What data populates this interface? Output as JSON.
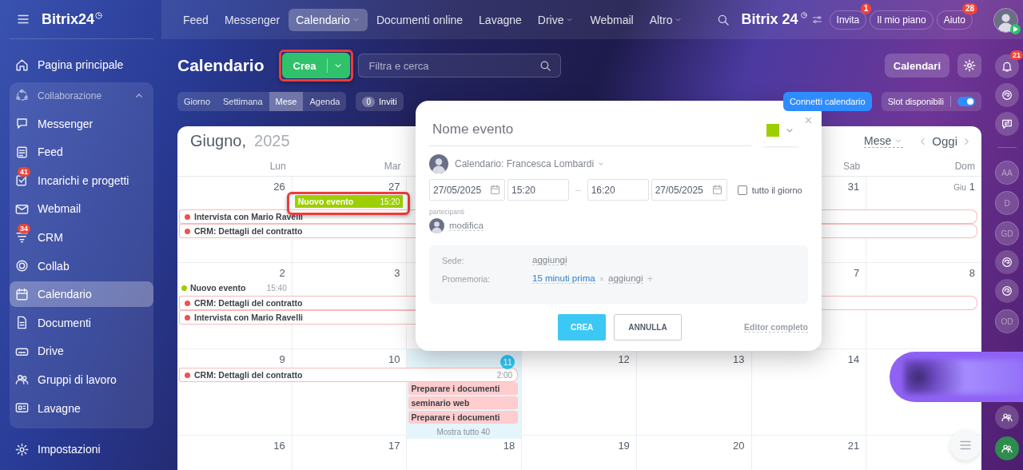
{
  "sidebar": {
    "logo": "Bitrix24",
    "items": [
      {
        "label": "Pagina principale",
        "selected": false
      }
    ],
    "group": {
      "label": "Collaborazione",
      "expanded": true,
      "items": [
        {
          "label": "Messenger",
          "selected": false
        },
        {
          "label": "Feed",
          "selected": false
        },
        {
          "label": "Incarichi e progetti",
          "badge": "41",
          "selected": false
        },
        {
          "label": "Webmail",
          "selected": false
        },
        {
          "label": "CRM",
          "badge": "34",
          "selected": false
        },
        {
          "label": "Collab",
          "selected": false
        },
        {
          "label": "Calendario",
          "selected": true
        },
        {
          "label": "Documenti",
          "selected": false
        },
        {
          "label": "Drive",
          "selected": false
        },
        {
          "label": "Gruppi di lavoro",
          "selected": false
        },
        {
          "label": "Lavagne",
          "selected": false
        }
      ]
    },
    "footer": "Impostazioni"
  },
  "topnav": {
    "items": [
      {
        "label": "Feed",
        "selected": false,
        "dropdown": false
      },
      {
        "label": "Messenger",
        "selected": false,
        "dropdown": false
      },
      {
        "label": "Calendario",
        "selected": true,
        "dropdown": true
      },
      {
        "label": "Documenti online",
        "selected": false,
        "dropdown": false
      },
      {
        "label": "Lavagne",
        "selected": false,
        "dropdown": false
      },
      {
        "label": "Drive",
        "selected": false,
        "dropdown": true
      },
      {
        "label": "Webmail",
        "selected": false,
        "dropdown": false
      },
      {
        "label": "Altro",
        "selected": false,
        "dropdown": true
      }
    ],
    "logo": "Bitrix 24",
    "buttons": [
      {
        "label": "Invita",
        "badge": "1"
      },
      {
        "label": "Il mio piano"
      },
      {
        "label": "Aiuto",
        "badge": "28"
      }
    ]
  },
  "toolbar": {
    "title": "Calendario",
    "create": {
      "label": "Crea",
      "highlighted": true
    },
    "search": {
      "placeholder": "Filtra e cerca"
    },
    "calendars_button": "Calendari"
  },
  "views": [
    {
      "label": "Giorno",
      "selected": false
    },
    {
      "label": "Settimana",
      "selected": false
    },
    {
      "label": "Mese",
      "selected": true
    },
    {
      "label": "Agenda",
      "selected": false
    }
  ],
  "invites": {
    "count": "0",
    "label": "Inviti"
  },
  "connect_button": "Connetti calendario",
  "slots": {
    "label": "Slot disponibili",
    "on": true
  },
  "calendar": {
    "month": "Giugno,",
    "year": "2025",
    "view_select": "Mese",
    "today_button": "Oggi",
    "weekdays": {
      "mon": "Lun",
      "tue": "Mar",
      "sat": "Sab",
      "sun": "Dom"
    },
    "weeks": [
      {
        "days": {
          "mon": {
            "number": "26",
            "today": false
          },
          "tue": {
            "number": "27",
            "today": false
          },
          "sat": {
            "number": "31",
            "today": false
          },
          "sun": {
            "month": "Giu",
            "number": "1",
            "today": false
          }
        },
        "lanes": [
          [
            {
              "kind": "fill",
              "title": "Nuovo evento",
              "time": "15:20",
              "color": "#9dcf00",
              "highlighted": true
            }
          ],
          [
            {
              "kind": "bar",
              "title": "Intervista con Mario Ravelli",
              "color": "#f0524f"
            }
          ],
          [
            {
              "kind": "bar",
              "title": "CRM: Dettagli del contratto",
              "color": "#f0524f"
            }
          ]
        ]
      },
      {
        "days": {
          "mon": {
            "number": "2",
            "today": false
          },
          "tue": {
            "number": "3",
            "today": false
          },
          "sat": {
            "number": "7",
            "today": false
          },
          "sun": {
            "number": "8",
            "today": false
          }
        },
        "lanes": [
          [
            {
              "kind": "dot",
              "title": "Nuovo evento",
              "time": "15:40",
              "color": "#9dcf00"
            }
          ],
          [
            {
              "kind": "bar",
              "title": "CRM: Dettagli del contratto",
              "color": "#f0524f"
            }
          ],
          [
            {
              "kind": "bar",
              "title": "Intervista con Mario Ravelli",
              "color": "#f0524f"
            }
          ]
        ]
      },
      {
        "days": {
          "mon": {
            "number": "9",
            "today": false
          },
          "tue": {
            "number": "10",
            "today": false
          },
          "wed": {
            "number": "11",
            "today": true
          },
          "thu": {
            "number": "12",
            "today": false
          },
          "fri": {
            "number": "13",
            "today": false
          },
          "sat": {
            "number": "14",
            "today": false
          }
        },
        "lanes": [
          [
            {
              "kind": "bar",
              "title": "CRM: Dettagli del contratto",
              "time": "2:00",
              "color": "#f0524f"
            }
          ],
          [
            {
              "kind": "block",
              "title": "Preparare i documenti",
              "color": "#ffcdcd"
            }
          ],
          [
            {
              "kind": "block",
              "title": "seminario web",
              "color": "#ffcdcd"
            }
          ],
          [
            {
              "kind": "block",
              "title": "Preparare i documenti",
              "color": "#ffcdcd"
            }
          ],
          [
            {
              "kind": "more",
              "title": "Mostra tutto 40"
            }
          ]
        ]
      },
      {
        "days": {
          "mon": {
            "number": "16",
            "today": false
          },
          "tue": {
            "number": "17",
            "today": false
          },
          "wed": {
            "number": "18",
            "today": false
          },
          "thu": {
            "number": "19",
            "today": false
          },
          "fri": {
            "number": "20",
            "today": false
          },
          "sat": {
            "number": "21",
            "today": false
          }
        }
      }
    ]
  },
  "popup": {
    "title_placeholder": "Nome evento",
    "color": "#9dcf00",
    "close": "×",
    "calendar": "Calendario: Francesca Lombardi",
    "date_from": "27/05/2025",
    "time_from": "15:20",
    "separator": "–",
    "time_to": "16:20",
    "date_to": "27/05/2025",
    "all_day": {
      "label": "tutto il giorno",
      "checked": false
    },
    "participants_label": "partecipanti",
    "participants_link": "modifica",
    "location": {
      "label": "Sede:",
      "value": "aggiungi"
    },
    "reminder": {
      "label": "Promemoria:",
      "value": "15 minuti prima",
      "remove": "×",
      "add": "aggiungi",
      "plus": "+"
    },
    "buttons": [
      {
        "label": "CREA",
        "kind": "primary"
      },
      {
        "label": "ANNULLA",
        "kind": "secondary"
      }
    ],
    "full_editor": "Editor completo"
  },
  "right_strip": {
    "items": [
      {
        "kind": "bell",
        "badge": "21"
      },
      {
        "kind": "swirl"
      },
      {
        "kind": "chat"
      },
      {
        "kind": "divider"
      },
      {
        "kind": "initials",
        "text": "AA"
      },
      {
        "kind": "initials",
        "text": "D"
      },
      {
        "kind": "initials",
        "text": "GD"
      },
      {
        "kind": "swirl"
      },
      {
        "kind": "swirl"
      },
      {
        "kind": "initials",
        "text": "OD"
      }
    ],
    "bottom": [
      {
        "kind": "group",
        "active": false
      },
      {
        "kind": "group",
        "active": true
      }
    ]
  }
}
